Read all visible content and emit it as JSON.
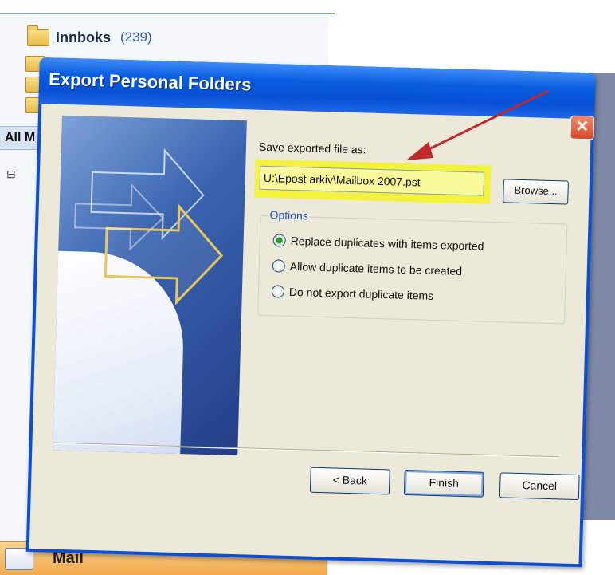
{
  "background_window": {
    "folder_label": "Innboks",
    "folder_count": "(239)",
    "nav_partial_label": "All M",
    "mail_bar_label": "Mail"
  },
  "dialog": {
    "title": "Export Personal Folders",
    "close_glyph": "✕",
    "save_label": "Save exported file as:",
    "file_path": "U:\\Epost arkiv\\Mailbox 2007.pst",
    "browse_label": "Browse...",
    "options_legend": "Options",
    "options": [
      {
        "label": "Replace duplicates with items exported",
        "checked": true
      },
      {
        "label": "Allow duplicate items to be created",
        "checked": false
      },
      {
        "label": "Do not export duplicate items",
        "checked": false
      }
    ],
    "buttons": {
      "back": "< Back",
      "finish": "Finish",
      "cancel": "Cancel"
    }
  },
  "colors": {
    "titlebar": "#0a5de0",
    "highlight": "#f5f23d",
    "annotation_arrow": "#c0282a"
  }
}
